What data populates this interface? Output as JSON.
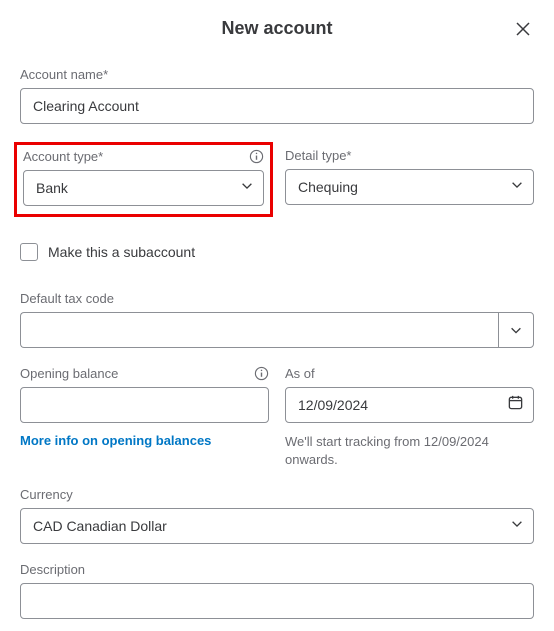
{
  "header": {
    "title": "New account"
  },
  "account_name": {
    "label": "Account name*",
    "value": "Clearing Account"
  },
  "account_type": {
    "label": "Account type*",
    "value": "Bank"
  },
  "detail_type": {
    "label": "Detail type*",
    "value": "Chequing"
  },
  "subaccount": {
    "label": "Make this a subaccount"
  },
  "default_tax": {
    "label": "Default tax code",
    "value": ""
  },
  "opening_balance": {
    "label": "Opening balance",
    "value": "",
    "link": "More info on opening balances"
  },
  "as_of": {
    "label": "As of",
    "value": "12/09/2024",
    "helper": "We'll start tracking from 12/09/2024 onwards."
  },
  "currency": {
    "label": "Currency",
    "value": "CAD Canadian Dollar"
  },
  "description": {
    "label": "Description",
    "value": ""
  }
}
